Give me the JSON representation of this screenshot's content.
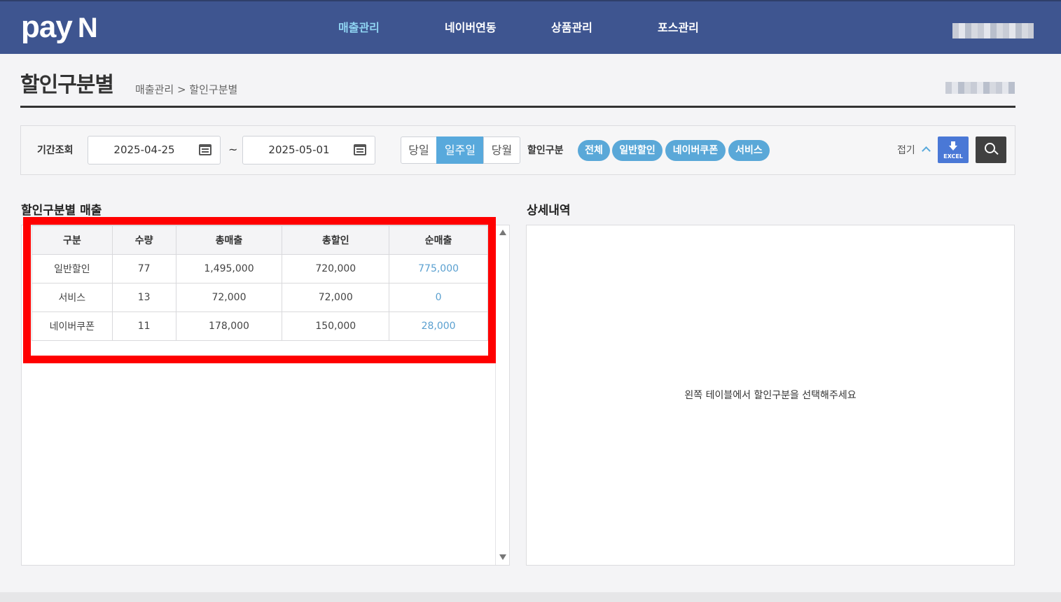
{
  "nav": {
    "logo": "pay",
    "logo_mark": "N",
    "items": [
      {
        "label": "매출관리",
        "active": true
      },
      {
        "label": "네이버연동",
        "active": false
      },
      {
        "label": "상품관리",
        "active": false
      },
      {
        "label": "포스관리",
        "active": false
      }
    ]
  },
  "page": {
    "title": "할인구분별",
    "breadcrumb": "매출관리 > 할인구분별"
  },
  "filter": {
    "period_label": "기간조회",
    "start_date": "2025-04-25",
    "end_date": "2025-05-01",
    "separator": "~",
    "ranges": [
      {
        "label": "당일",
        "active": false
      },
      {
        "label": "일주일",
        "active": true
      },
      {
        "label": "당월",
        "active": false
      }
    ],
    "discount_label": "할인구분",
    "discount_types": [
      "전체",
      "일반할인",
      "네이버쿠폰",
      "서비스"
    ],
    "fold_label": "접기",
    "excel_label": "EXCEL"
  },
  "left": {
    "title": "할인구분별 매출",
    "columns": [
      "구분",
      "수량",
      "총매출",
      "총할인",
      "순매출"
    ],
    "rows": [
      [
        "일반할인",
        "77",
        "1,495,000",
        "720,000",
        "775,000"
      ],
      [
        "서비스",
        "13",
        "72,000",
        "72,000",
        "0"
      ],
      [
        "네이버쿠폰",
        "11",
        "178,000",
        "150,000",
        "28,000"
      ]
    ]
  },
  "right": {
    "title": "상세내역",
    "empty_message": "왼쪽 테이블에서 할인구분을 선택해주세요"
  },
  "colors": {
    "nav_bg": "#3e5590",
    "nav_active": "#8fd4f2",
    "accent": "#58a9dc",
    "highlight": "#ff0000"
  }
}
